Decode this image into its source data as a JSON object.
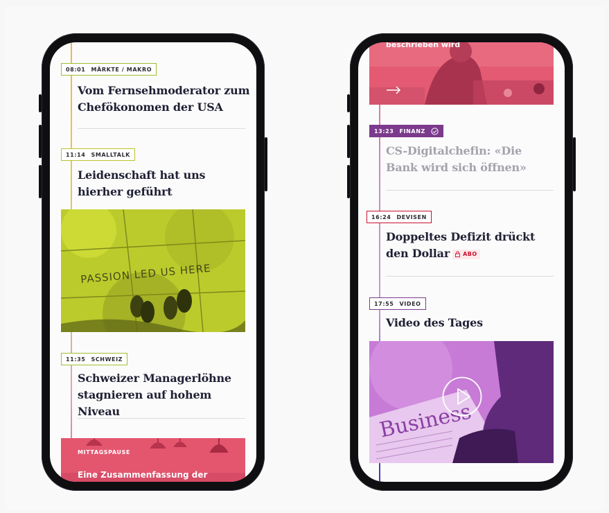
{
  "colors": {
    "background": "#f7f7f8",
    "phone_body": "#0f0f12",
    "headline": "#1f2033",
    "muted_headline": "#a3a3ab",
    "maerkte": "#9fbf2e",
    "smalltalk": "#b8c52a",
    "schweiz": "#9fbf2e",
    "finanz": "#7b3a8c",
    "devisen": "#c8102e",
    "video": "#7b3a8c",
    "mittagspause": "#e0506a"
  },
  "left_phone": {
    "items": [
      {
        "time": "08:01",
        "category": "MÄRKTE / MAKRO",
        "headline": "Vom Fernsehmoderator zum Chefökonomen der USA"
      },
      {
        "time": "11:14",
        "category": "SMALLTALK",
        "headline": "Leidenschaft hat uns hierher geführt",
        "image_caption": "PASSION LED US HERE"
      },
      {
        "time": "11:35",
        "category": "SCHWEIZ",
        "headline": "Schweizer Managerlöhne stagnieren auf hohem Niveau"
      }
    ],
    "promo": {
      "kicker": "MITTAGSPAUSE",
      "title": "Eine Zusammenfassung der"
    }
  },
  "right_phone": {
    "top_card": {
      "partial_text": "beschrieben wird",
      "arrow_icon": "arrow-right-icon"
    },
    "items": [
      {
        "time": "13:23",
        "category": "FINANZ",
        "headline": "CS-Digitalchefin: «Die Bank wird sich öffnen»",
        "read_icon": "check-circle-icon"
      },
      {
        "time": "16:24",
        "category": "DEVISEN",
        "headline": "Doppeltes Defizit drückt den Dollar",
        "badge": "ABO",
        "badge_icon": "lock-icon"
      },
      {
        "time": "17:55",
        "category": "VIDEO",
        "headline": "Video des Tages",
        "image_text": "Business",
        "play_icon": "play-icon"
      }
    ]
  }
}
